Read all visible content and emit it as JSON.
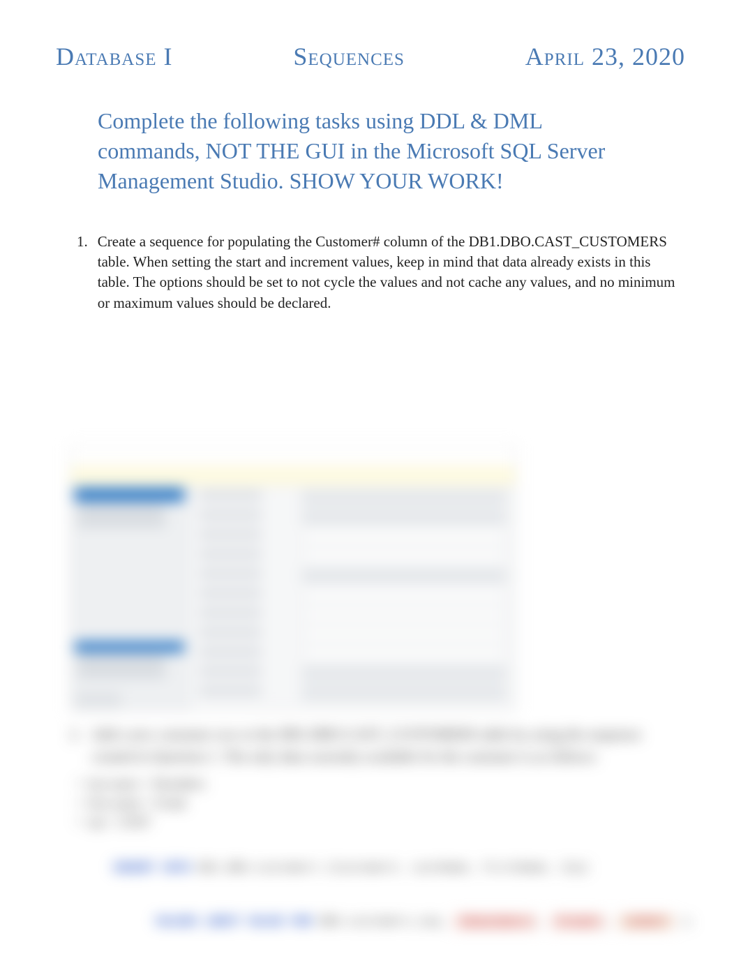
{
  "header": {
    "left": "Database I",
    "center": "Sequences",
    "right": "April 23, 2020"
  },
  "instructions": "Complete the following tasks using DDL & DML commands, NOT THE GUI in the Microsoft SQL Server Management Studio. SHOW YOUR WORK!",
  "q1": {
    "number": "1.",
    "text": "Create a sequence for populating the Customer# column of the DB1.DBO.CAST_CUSTOMERS table. When setting the start and increment values, keep in mind that data already exists in this table. The options should be set to not cycle the values and not cache any values, and no minimum or maximum values should be declared."
  },
  "obscured": {
    "q2": {
      "number": "2.",
      "line1": "Add a new customer row to the DB1.DBO.CAST_CUSTOMERS table by using the sequence",
      "line2": "created in Question 1. The only data currently available for the customer is as follows:",
      "bullets": [
        "last name = Shoulders",
        "first name = Frank",
        "zip = 23567"
      ]
    },
    "code": {
      "l1": {
        "kw1": "INSERT",
        "kw2": "INTO",
        "rest": "DB1.DBO.customers (Customer#, LastName, FirstName, Zip)"
      },
      "l2": {
        "kw1": "VALUES",
        "kw2": "(NEXT",
        "kw3": "VALUE",
        "kw4": "FOR",
        "rest": "DBO.customers_seq,",
        "s1": "'Shoulders'",
        "c1": ",",
        "s2": "'Frank'",
        "c2": ",",
        "s3": "'23567'",
        "end": ");"
      }
    }
  }
}
